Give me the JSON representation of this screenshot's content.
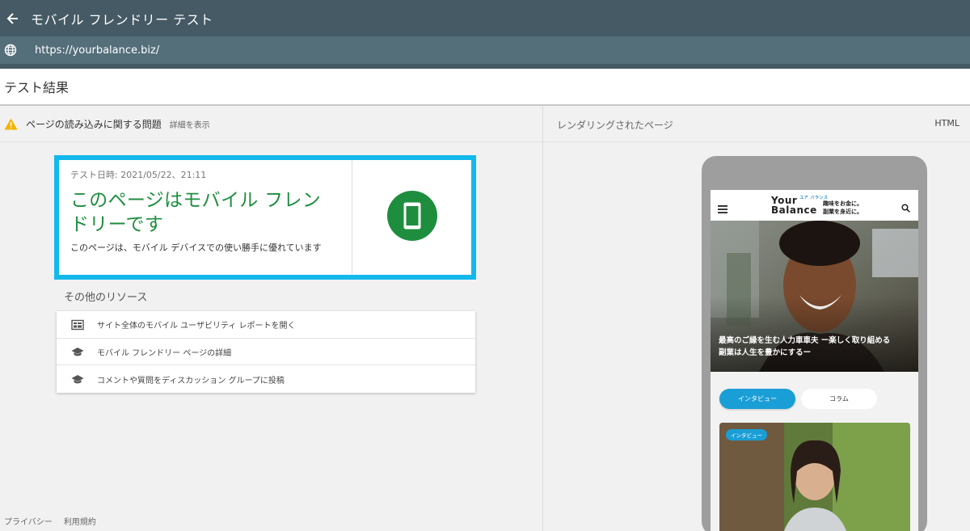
{
  "header": {
    "back_icon": "arrow-left-icon",
    "title": "モバイル フレンドリー テスト"
  },
  "url_bar": {
    "icon": "globe-icon",
    "url": "https://yourbalance.biz/"
  },
  "results": {
    "title": "テスト結果"
  },
  "issues": {
    "icon": "warning-icon",
    "text": "ページの読み込みに関する問題",
    "link": "詳細を表示"
  },
  "result_card": {
    "date": "テスト日時: 2021/05/22、21:11",
    "heading_line1": "このページはモバイル フレン",
    "heading_line2": "ドリーです",
    "description": "このページは、モバイル デバイスでの使い勝手に優れています",
    "icon": "mobile-phone-icon",
    "accent_color": "#1e8e3e",
    "highlight_color": "#14b9ec"
  },
  "resources": {
    "title": "その他のリソース",
    "items": [
      {
        "icon": "dashboard-icon",
        "label": "サイト全体のモバイル ユーザビリティ レポートを開く"
      },
      {
        "icon": "graduation-cap-icon",
        "label": "モバイル フレンドリー ページの詳細"
      },
      {
        "icon": "graduation-cap-icon",
        "label": "コメントや質問をディスカッション グループに投稿"
      }
    ]
  },
  "footer": {
    "privacy": "プライバシー",
    "terms": "利用規約"
  },
  "rendered": {
    "label": "レンダリングされたページ",
    "html_tab": "HTML"
  },
  "preview": {
    "logo_line1": "Your",
    "logo_ruby": "ユア バランス",
    "logo_line2": "Balance",
    "tagline_line1": "趣味をお金に。",
    "tagline_line2": "副業を身近に。",
    "hero_caption_line1": "最高のご縁を生む人力車車夫 ー楽しく取り組める",
    "hero_caption_line2": "副業は人生を豊かにするー",
    "tab_interview": "インタビュー",
    "tab_column": "コラム",
    "article_badge": "インタビュー",
    "accent_color": "#1a9ed6"
  }
}
